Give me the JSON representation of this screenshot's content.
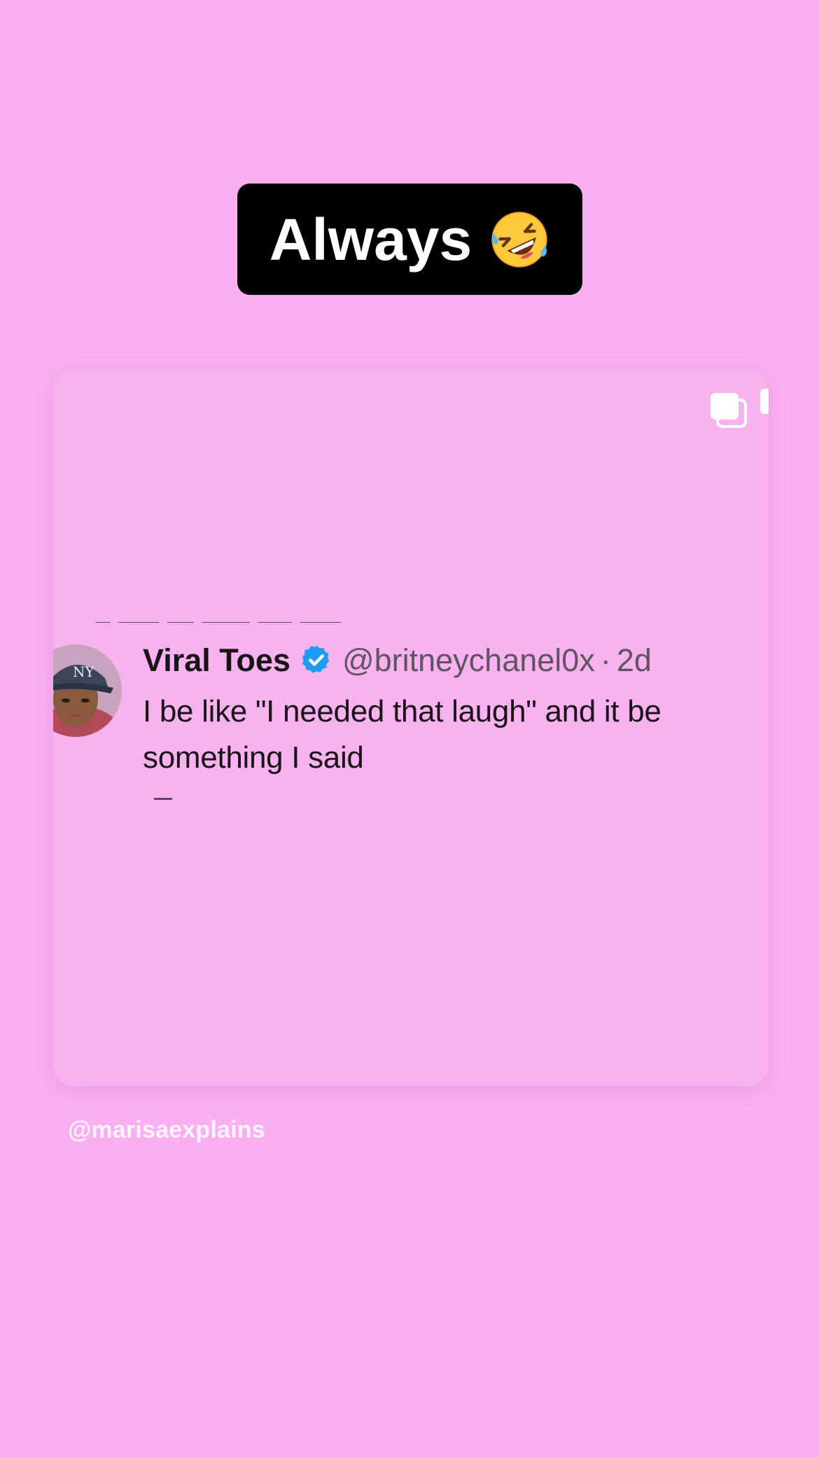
{
  "caption": {
    "text": "Always",
    "emoji_icon": "rolling-on-floor-laughing-emoji"
  },
  "post": {
    "multiple_images_icon": "multiple-images-icon",
    "tweet": {
      "display_name": "Viral Toes",
      "verified_icon": "verified-badge-icon",
      "handle": "@britneychanel0x",
      "separator": "·",
      "time": "2d",
      "text": "I be like \"I needed that laugh\" and it be something I said"
    }
  },
  "credit": "@marisaexplains",
  "colors": {
    "background": "#f8b0f1",
    "caption_bg": "#000000",
    "verified_blue": "#1d9bf0"
  }
}
